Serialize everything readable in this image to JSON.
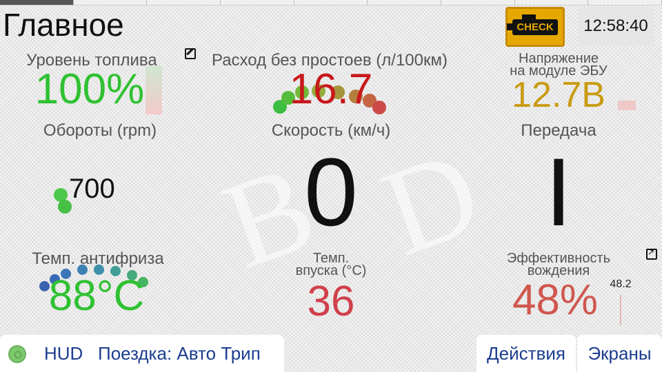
{
  "header": {
    "title": "Главное",
    "check_engine_label": "CHECK",
    "clock": "12:58:40"
  },
  "widgets": {
    "fuel_level": {
      "label": "Уровень топлива",
      "value": "100%",
      "color": "#2fc132"
    },
    "fuel_consumption": {
      "label": "Расход без простоев (л/100км)",
      "value": "16.7",
      "color": "#c8181b"
    },
    "voltage": {
      "label_line1": "Напряжение",
      "label_line2": "на модуле ЭБУ",
      "value": "12.7В",
      "color": "#c99b12"
    },
    "rpm": {
      "label": "Обороты (rpm)",
      "value": "700",
      "color": "#111111"
    },
    "speed": {
      "label": "Скорость (км/ч)",
      "value": "0",
      "color": "#111111"
    },
    "gear": {
      "label": "Передача",
      "value": "I",
      "color": "#111111"
    },
    "coolant_temp": {
      "label": "Темп. антифриза",
      "value": "88°C",
      "color": "#2fc132"
    },
    "intake_temp": {
      "label_line1": "Темп.",
      "label_line2": "впуска (°C)",
      "value": "36",
      "color": "#d0404a"
    },
    "efficiency": {
      "label_line1": "Эффективность",
      "label_line2": "вождения",
      "value": "48%",
      "color": "#d0574f",
      "secondary_value": "48.2"
    }
  },
  "bottom_bar": {
    "hud_label": "HUD",
    "trip_label": "Поездка: Авто Трип",
    "actions_label": "Действия",
    "screens_label": "Экраны"
  },
  "icons": {
    "edit": "edit-icon",
    "expand": "expand-icon",
    "status": "status-circle-icon",
    "engine": "check-engine-icon"
  }
}
